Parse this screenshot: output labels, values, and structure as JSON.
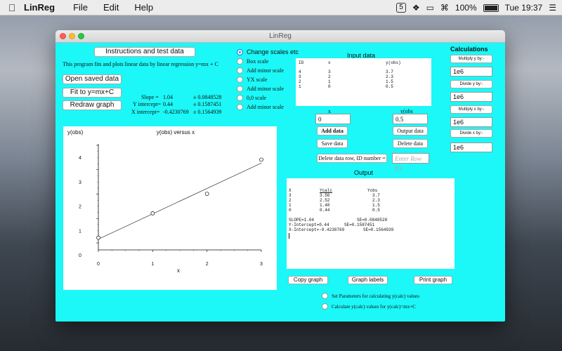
{
  "menubar": {
    "app": "LinReg",
    "items": [
      "File",
      "Edit",
      "Help"
    ],
    "battery": "100%",
    "clock": "Tue 19:37",
    "notif_badge": "5"
  },
  "window": {
    "title": "LinReg"
  },
  "left": {
    "instructions_button": "Instructions and test data",
    "description": "This program fits and plots linear data by linear regression y=mx + C",
    "open_saved_button": "Open saved data",
    "fit_button": "Fit to y=mx+C",
    "redraw_button": "Redraw graph"
  },
  "stats": {
    "slope_label": "Slope =",
    "slope_value": "1.04",
    "slope_se": "± 0.0848528",
    "yint_label": "Y intercept=",
    "yint_value": "0.44",
    "yint_se": "± 0.1587451",
    "xint_label": "X intercept=",
    "xint_value": "-0.4230769",
    "xint_se": "± 0.1564939"
  },
  "scales": {
    "change_scales": "Change scales etc",
    "options": [
      "Box scale",
      "Add minor scale",
      "YX scale",
      "Add minor scale",
      "0,0 scale",
      "Add minor scale"
    ]
  },
  "input_data": {
    "title": "Input data",
    "headers": [
      "ID",
      "x",
      "y(obs)"
    ],
    "rows": [
      [
        "4",
        "3",
        "3.7"
      ],
      [
        "3",
        "2",
        "2.3"
      ],
      [
        "2",
        "1",
        "1.5"
      ],
      [
        "1",
        "0",
        "0.5"
      ]
    ],
    "x_label": "x",
    "y_label": "y(obs",
    "x_value": "0",
    "y_value": "0.5",
    "add_button": "Add data",
    "output_button": "Output data",
    "save_button": "Save data",
    "delete_button": "Delete data",
    "delete_row_button": "Delete data row, ID number =",
    "row_id_placeholder": "Enter Row ID"
  },
  "calculations": {
    "title": "Calculations",
    "multiply_y": "Multiply y by:-",
    "multiply_y_value": "1e6",
    "divide_y": "Divide y by:-",
    "divide_y_value": "1e6",
    "multiply_x": "Multiply x by:-",
    "multiply_x_value": "1e6",
    "divide_x": "Divide x by:-",
    "divide_x_value": "1e6"
  },
  "output": {
    "title": "Output",
    "header": [
      "X",
      "Ycalc",
      "Yobs"
    ],
    "rows": [
      [
        "3",
        "3.56",
        "3.7"
      ],
      [
        "2",
        "2.52",
        "2.3"
      ],
      [
        "1",
        "1.48",
        "1.5"
      ],
      [
        "0",
        "0.44",
        "0.5"
      ]
    ],
    "slope_line": "SLOPE=1.04",
    "slope_se_line": "SE=0.0848528",
    "yint_line": "Y-Intercept=0.44",
    "yint_se_line": "SE=0.1587451",
    "xint_line": "X-Intercept=-0.4230769",
    "xint_se_line": "SE=0.1564939"
  },
  "bottom": {
    "copy_graph": "Copy graph",
    "graph_labels": "Graph labels",
    "print_graph": "Print graph",
    "set_params": "Set Parameters for calculating y(calc) values",
    "calc_values": "Calculate y(calc) values for y(calc)=mx+C"
  },
  "chart_data": {
    "type": "scatter",
    "title": "y(obs) versus x",
    "xlabel": "x",
    "ylabel": "y(obs)",
    "xlim": [
      0,
      3
    ],
    "ylim": [
      0,
      4
    ],
    "x_ticks": [
      "0",
      "1",
      "2",
      "3"
    ],
    "y_ticks": [
      "0",
      "1",
      "2",
      "3",
      "4"
    ],
    "points": [
      [
        0,
        0.5
      ],
      [
        1,
        1.5
      ],
      [
        2,
        2.3
      ],
      [
        3,
        3.7
      ]
    ],
    "fit_line": {
      "slope": 1.04,
      "intercept": 0.44
    },
    "grid": false
  }
}
